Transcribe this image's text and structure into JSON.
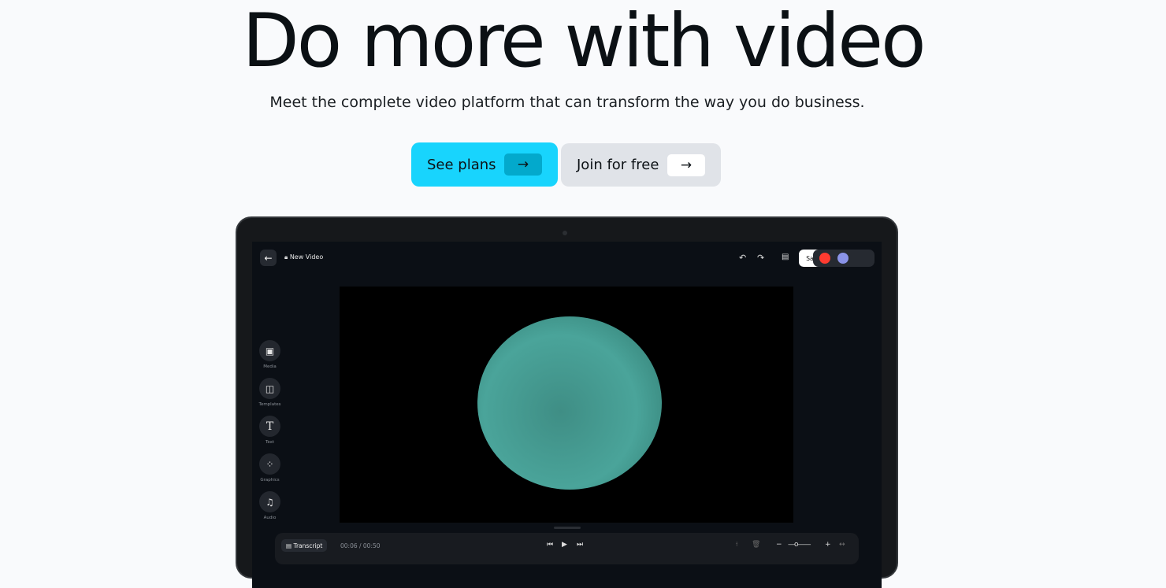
{
  "hero": {
    "title": "Do more with video",
    "subtitle": "Meet the complete video platform that can transform the way you do business."
  },
  "cta": {
    "primary": "See plans",
    "secondary": "Join for free",
    "arrow": "→"
  },
  "colors": {
    "primary": "#18d4fd",
    "secondary": "#e0e3e8",
    "video_circle": "#4aa49a"
  },
  "editor": {
    "project_title": "New Video",
    "save_label": "Save",
    "sidebar": [
      {
        "label": "Media",
        "icon": "image-icon",
        "glyph": "▣"
      },
      {
        "label": "Templates",
        "icon": "layout-icon",
        "glyph": "◫"
      },
      {
        "label": "Text",
        "icon": "text-icon",
        "glyph": "T"
      },
      {
        "label": "Graphics",
        "icon": "shapes-icon",
        "glyph": "⁘"
      },
      {
        "label": "Audio",
        "icon": "music-icon",
        "glyph": "♫"
      }
    ],
    "transcript_label": "Transcript",
    "time": "00:06 / 00:50"
  }
}
